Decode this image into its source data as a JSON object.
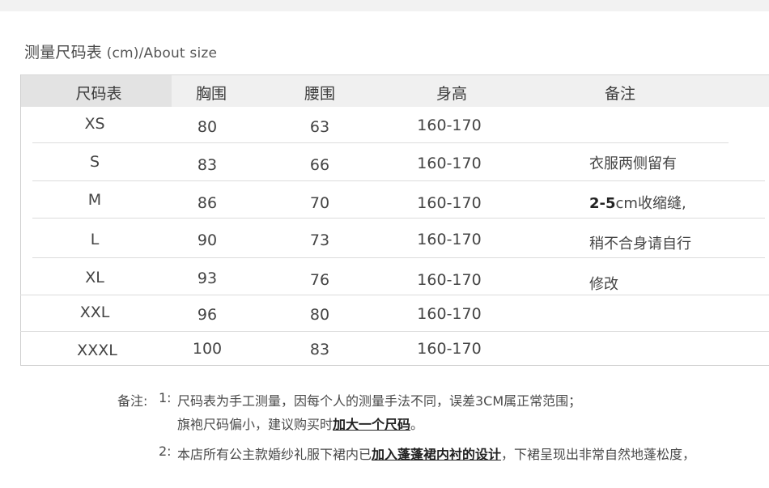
{
  "title": {
    "main": "测量尺码表",
    "sub": " (cm)/About size"
  },
  "table": {
    "headers": [
      "尺码表",
      "胸围",
      "腰围",
      "身高",
      "备注"
    ],
    "rows": [
      {
        "size": "XS",
        "chest": "80",
        "waist": "63",
        "height": "160-170"
      },
      {
        "size": "S",
        "chest": "83",
        "waist": "66",
        "height": "160-170"
      },
      {
        "size": "M",
        "chest": "86",
        "waist": "70",
        "height": "160-170"
      },
      {
        "size": "L",
        "chest": "90",
        "waist": "73",
        "height": "160-170"
      },
      {
        "size": "XL",
        "chest": "93",
        "waist": "76",
        "height": "160-170"
      },
      {
        "size": "XXL",
        "chest": "96",
        "waist": "80",
        "height": "160-170"
      },
      {
        "size": "XXXL",
        "chest": "100",
        "waist": "83",
        "height": "160-170"
      }
    ],
    "remarks": {
      "line1": "衣服两侧留有",
      "line2_bold": "2-5",
      "line2_rest": "cm收缩缝,",
      "line3": "稍不合身请自行",
      "line4": "修改"
    }
  },
  "footnotes": {
    "label": "备注:",
    "n1": "1:",
    "line1": "尺码表为手工测量，因每个人的测量手法不同，误差3CM属正常范围；",
    "line2_plain": "旗袍尺码偏小，建议购买时",
    "line2_em": "加大一个尺码",
    "line2_end": "。",
    "n2": "2:",
    "line3_a": "本店所有公主款婚纱礼服下裙内已",
    "line3_em": "加入蓬蓬裙内衬的设计",
    "line3_b": "，下裙呈现出非常自然地蓬松度，"
  }
}
